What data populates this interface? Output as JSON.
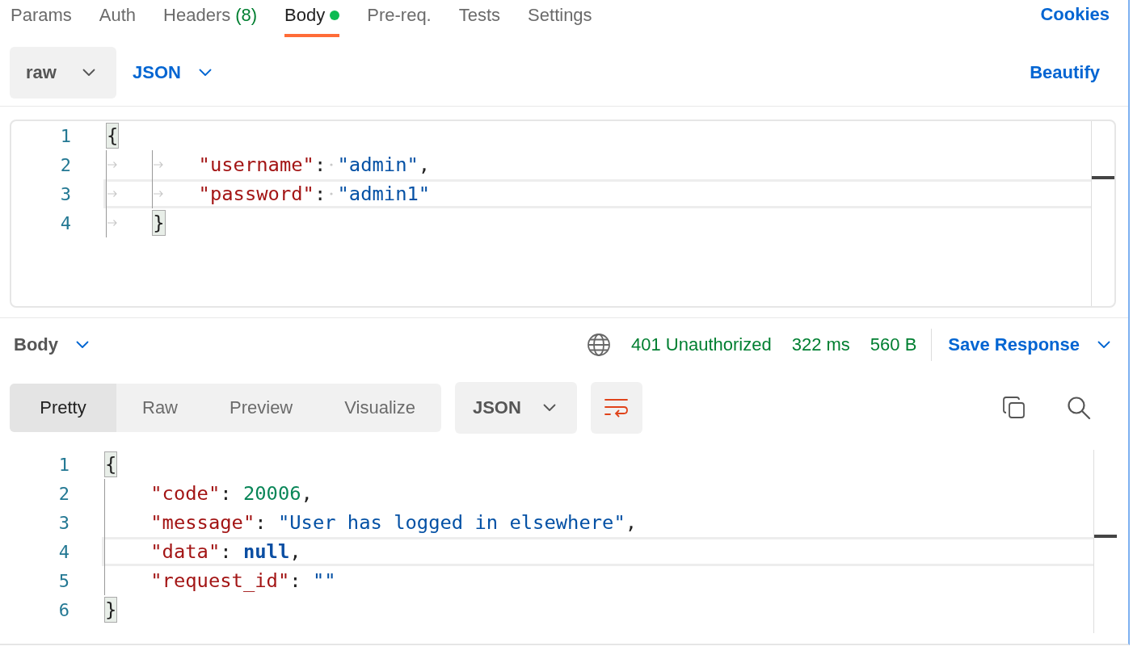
{
  "request_tabs": [
    {
      "label": "Params",
      "selected": false
    },
    {
      "label": "Auth",
      "selected": false
    },
    {
      "label": "Headers",
      "count": "(8)",
      "selected": false
    },
    {
      "label": "Body",
      "modified": true,
      "selected": true
    },
    {
      "label": "Pre-req.",
      "selected": false
    },
    {
      "label": "Tests",
      "selected": false
    },
    {
      "label": "Settings",
      "selected": false
    }
  ],
  "cookies_link": "Cookies",
  "body_mode": "raw",
  "body_language": "JSON",
  "beautify_button": "Beautify",
  "request_editor": {
    "lines": [
      {
        "number": "1",
        "current": false,
        "tokens": [
          {
            "kind": "brace",
            "text": "{",
            "matched": true
          }
        ]
      },
      {
        "number": "2",
        "current": false,
        "tokens": [
          {
            "kind": "tab"
          },
          {
            "kind": "tab"
          },
          {
            "kind": "key",
            "text": "\"username\""
          },
          {
            "kind": "punct",
            "text": ":"
          },
          {
            "kind": "space"
          },
          {
            "kind": "str",
            "text": "\"admin\""
          },
          {
            "kind": "punct",
            "text": ","
          }
        ]
      },
      {
        "number": "3",
        "current": true,
        "tokens": [
          {
            "kind": "tab"
          },
          {
            "kind": "tab"
          },
          {
            "kind": "key",
            "text": "\"password\""
          },
          {
            "kind": "punct",
            "text": ":"
          },
          {
            "kind": "space"
          },
          {
            "kind": "str",
            "text": "\"admin1\""
          }
        ]
      },
      {
        "number": "4",
        "current": false,
        "tokens": [
          {
            "kind": "tab"
          },
          {
            "kind": "brace",
            "text": "}",
            "matched": true
          }
        ]
      }
    ]
  },
  "response": {
    "section": "Body",
    "status": "401 Unauthorized",
    "time": "322 ms",
    "size": "560 B",
    "save_button": "Save Response",
    "view_tabs": [
      {
        "label": "Pretty",
        "selected": true
      },
      {
        "label": "Raw",
        "selected": false
      },
      {
        "label": "Preview",
        "selected": false
      },
      {
        "label": "Visualize",
        "selected": false
      }
    ],
    "format": "JSON",
    "wrap_lines": true,
    "editor": {
      "lines": [
        {
          "number": "1",
          "current": false,
          "tokens": [
            {
              "kind": "brace",
              "text": "{",
              "matched": true
            }
          ]
        },
        {
          "number": "2",
          "current": false,
          "tokens": [
            {
              "kind": "indent"
            },
            {
              "kind": "key",
              "text": "\"code\""
            },
            {
              "kind": "punct",
              "text": ": "
            },
            {
              "kind": "num",
              "text": "20006"
            },
            {
              "kind": "punct",
              "text": ","
            }
          ]
        },
        {
          "number": "3",
          "current": false,
          "tokens": [
            {
              "kind": "indent"
            },
            {
              "kind": "key",
              "text": "\"message\""
            },
            {
              "kind": "punct",
              "text": ": "
            },
            {
              "kind": "str",
              "text": "\"User has logged in elsewhere\""
            },
            {
              "kind": "punct",
              "text": ","
            }
          ]
        },
        {
          "number": "4",
          "current": true,
          "tokens": [
            {
              "kind": "indent"
            },
            {
              "kind": "key",
              "text": "\"data\""
            },
            {
              "kind": "punct",
              "text": ": "
            },
            {
              "kind": "kw",
              "text": "null"
            },
            {
              "kind": "punct",
              "text": ","
            }
          ]
        },
        {
          "number": "5",
          "current": false,
          "tokens": [
            {
              "kind": "indent"
            },
            {
              "kind": "key",
              "text": "\"request_id\""
            },
            {
              "kind": "punct",
              "text": ": "
            },
            {
              "kind": "str",
              "text": "\"\""
            }
          ]
        },
        {
          "number": "6",
          "current": false,
          "tokens": [
            {
              "kind": "brace",
              "text": "}",
              "matched": true
            }
          ]
        }
      ]
    }
  }
}
